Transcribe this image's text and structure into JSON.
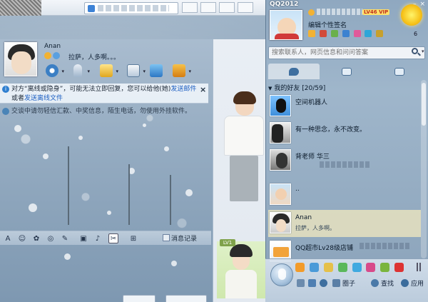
{
  "qq_main": {
    "title": "QQ2012",
    "signature": "编辑个性签名",
    "vip_label": "LV46 VIP",
    "mail_count": "6",
    "search": {
      "placeholder": "搜索联系人，网页信息和问问答案"
    },
    "group": {
      "name": "我的好友",
      "count": "[20/59]"
    },
    "contacts": [
      {
        "name": "空间机器人",
        "signature": ""
      },
      {
        "name": "有一种思念，永不改变。",
        "signature": ""
      },
      {
        "name": "背老师 华三",
        "signature": ""
      },
      {
        "name": "..",
        "signature": ""
      },
      {
        "name": "Anan",
        "signature": "拉萨，人多啊。"
      },
      {
        "name": "QQ超市Lv28级店铺",
        "signature": ""
      }
    ],
    "bottom": {
      "circle_label": "圈子",
      "find_label": "查找",
      "apps_label": "应用"
    },
    "colors": {
      "panel": "#9fb6cb",
      "selected_row": "#e6e2be",
      "accent": "#2f7fd0"
    }
  },
  "chat": {
    "contact_name": "Anan",
    "contact_signature": "拉萨，人多啊。。。",
    "offline_notice": {
      "text1": "对方“离线或隐身”，可能无法立即回复，您可以给他(她)",
      "link1": "发送邮件",
      "text2": "或者",
      "link2": "发送离线文件"
    },
    "security_tip": "交谈中请勿轻信汇款、中奖信息，陌生电话，勿使用外挂软件。",
    "history_label": "消息记录",
    "close_label": "×",
    "show_level": "LV1"
  },
  "icons": {
    "toolbar": [
      "video-call-icon",
      "voice-call-icon",
      "file-transfer-icon",
      "app-icon",
      "remote-desktop-icon",
      "more-apps-icon"
    ],
    "input_toolbar": [
      "font-icon",
      "emoji-icon",
      "magic-emoji-icon",
      "shake-icon",
      "scrawl-icon",
      "image-icon",
      "music-icon",
      "screenshot-icon",
      "gift-icon"
    ]
  }
}
